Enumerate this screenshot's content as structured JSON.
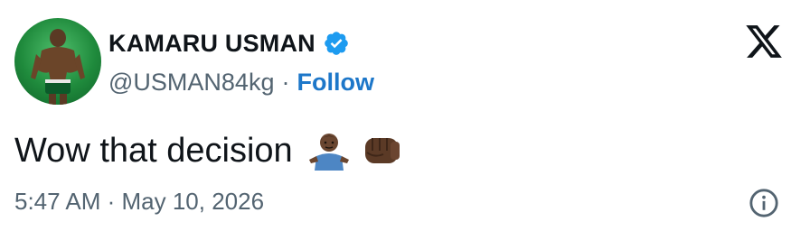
{
  "tweet": {
    "display_name": "KAMARU USMAN",
    "handle": "@USMAN84kg",
    "separator": "·",
    "follow_label": "Follow",
    "text": "Wow that decision",
    "timestamp": "5:47 AM · May 10, 2026"
  },
  "icons": {
    "verified": "verified-badge-icon",
    "logo": "x-logo-icon",
    "info": "info-icon",
    "emojis": [
      "person-shrugging-emoji",
      "oncoming-fist-emoji"
    ]
  },
  "colors": {
    "text": "#0f1419",
    "secondary": "#536471",
    "follow": "#1d77c9",
    "verified": "#1d9bf0",
    "avatar_bg": "#1f8a3c"
  }
}
